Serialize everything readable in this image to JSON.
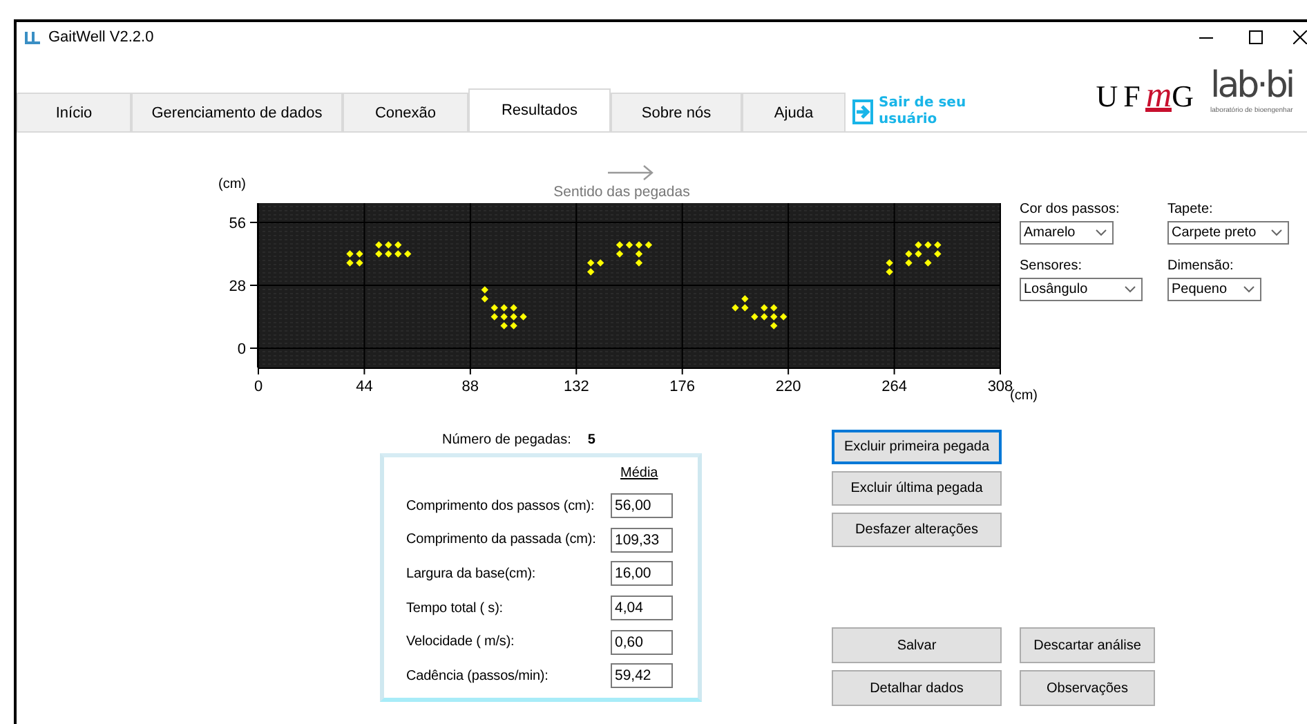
{
  "window": {
    "title": "GaitWell V2.2.0"
  },
  "ufmg_logo": {
    "text_before": "UF",
    "highlight": "m",
    "text_after": "G"
  },
  "labbio_logo": {
    "name": "lab·bi",
    "subtitle": "laboratório de bioengenhar"
  },
  "tabs": [
    {
      "label": "Início",
      "selected": false
    },
    {
      "label": "Gerenciamento de dados",
      "selected": false
    },
    {
      "label": "Conexão",
      "selected": false
    },
    {
      "label": "Resultados",
      "selected": true
    },
    {
      "label": "Sobre nós",
      "selected": false
    },
    {
      "label": "Ajuda",
      "selected": false
    }
  ],
  "logout": {
    "label": "Sair de seu usuário"
  },
  "chart": {
    "direction_label": "Sentido das pegadas",
    "chart_data": {
      "type": "scatter",
      "xlabel": "(cm)",
      "ylabel": "(cm)",
      "xlim": [
        0,
        308
      ],
      "ylim": [
        -8.6,
        64.6
      ],
      "xticks": [
        0,
        44,
        88,
        132,
        176,
        220,
        264,
        308
      ],
      "yticks": [
        0,
        28,
        56
      ],
      "grid": true,
      "series": [
        {
          "color": "#ffff00",
          "x": [
            38,
            42,
            38,
            42,
            50,
            54,
            58,
            50,
            54,
            58,
            62,
            94,
            94,
            98,
            102,
            106,
            98,
            102,
            106,
            110,
            102,
            106,
            138,
            142,
            138,
            150,
            154,
            158,
            162,
            150,
            158,
            158,
            198,
            202,
            202,
            206,
            210,
            214,
            210,
            214,
            218,
            214,
            262,
            262,
            270,
            274,
            278,
            282,
            270,
            274,
            282,
            278
          ],
          "values": [
            42,
            42,
            38,
            38,
            46,
            46,
            46,
            42,
            42,
            42,
            42,
            26,
            22,
            18,
            18,
            18,
            14,
            14,
            14,
            14,
            10,
            10,
            38,
            38,
            34,
            46,
            46,
            46,
            46,
            42,
            42,
            38,
            18,
            18,
            22,
            14,
            18,
            18,
            14,
            14,
            14,
            10,
            38,
            34,
            38,
            46,
            46,
            46,
            42,
            42,
            42,
            38
          ]
        }
      ]
    }
  },
  "settings": [
    {
      "label": "Cor dos passos:",
      "value": "Amarelo"
    },
    {
      "label": "Tapete:",
      "value": "Carpete preto"
    },
    {
      "label": "Sensores:",
      "value": "Losângulo"
    },
    {
      "label": "Dimensão:",
      "value": "Pequeno"
    }
  ],
  "summary": {
    "count_label": "Número de pegadas:",
    "count": "5",
    "column_heading": "Média",
    "rows": [
      {
        "label": "Comprimento dos passos (cm):",
        "value": "56,00"
      },
      {
        "label": "Comprimento da passada (cm):",
        "value": "109,33"
      },
      {
        "label": "Largura da base(cm):",
        "value": "16,00"
      },
      {
        "label": "Tempo total ( s):",
        "value": "4,04"
      },
      {
        "label": "Velocidade ( m/s):",
        "value": "0,60"
      },
      {
        "label": "Cadência (passos/min):",
        "value": "59,42"
      }
    ]
  },
  "buttons": [
    {
      "label": "Excluir primeira pegada",
      "focused": true
    },
    {
      "label": "Excluir última pegada",
      "focused": false
    },
    {
      "label": "Desfazer alterações",
      "focused": false
    },
    {
      "label": "Salvar",
      "focused": false
    },
    {
      "label": "Descartar análise",
      "focused": false
    },
    {
      "label": "Detalhar dados",
      "focused": false
    },
    {
      "label": "Observações",
      "focused": false
    }
  ]
}
